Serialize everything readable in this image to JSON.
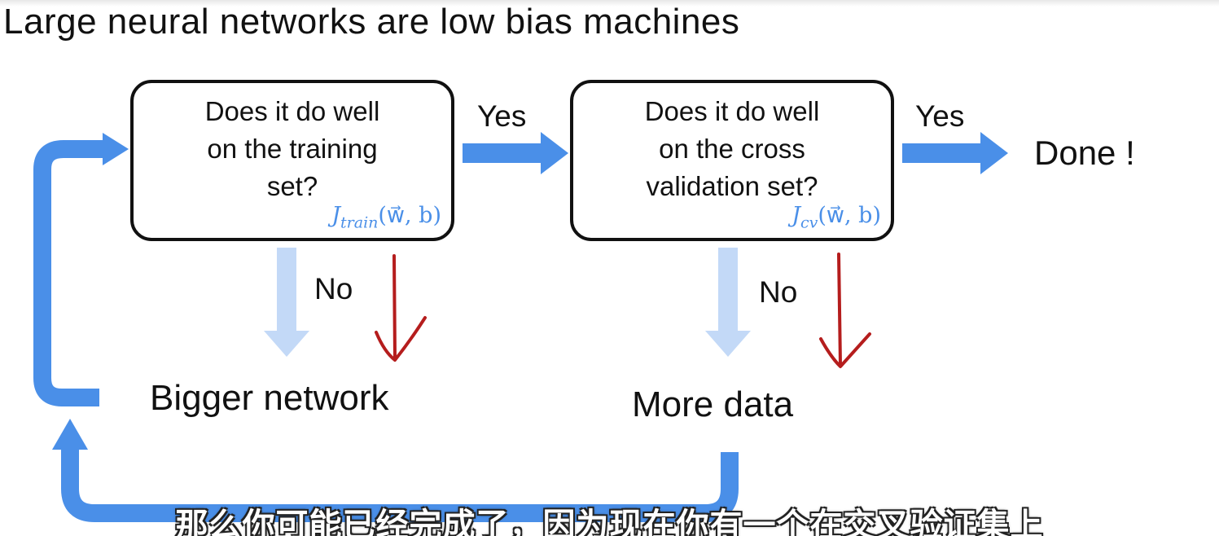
{
  "title": "Large neural networks are low bias machines",
  "box_training": {
    "lines": [
      "Does it do well",
      "on the training",
      "set?"
    ],
    "formula_j": "J",
    "formula_sub": "train",
    "formula_args": "(w⃗, b)"
  },
  "box_cv": {
    "lines": [
      "Does it do well",
      "on the cross",
      "validation set?"
    ],
    "formula_j": "J",
    "formula_sub": "cv",
    "formula_args": "(w⃗, b)"
  },
  "labels": {
    "yes_1": "Yes",
    "yes_2": "Yes",
    "no_1": "No",
    "no_2": "No"
  },
  "outcomes": {
    "done": "Done !",
    "bigger_network": "Bigger network",
    "more_data": "More data"
  },
  "subtitle": "那么你可能已经完成了，因为现在你有一个在交叉验证集上",
  "colors": {
    "arrow_blue": "#4a8fe8",
    "arrow_light_blue": "#c3d9f7",
    "annotation_red": "#b51d1d",
    "formula_blue": "#4a8fe8"
  }
}
